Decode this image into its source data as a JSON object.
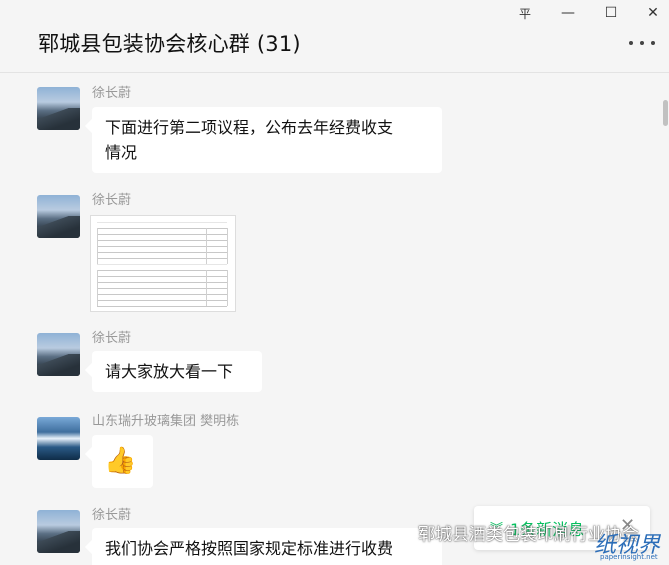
{
  "window": {
    "title": "郓城县包装协会核心群 (31)",
    "controls": {
      "pin": "平",
      "minimize": "—",
      "maximize": "☐",
      "close": "✕"
    },
    "more_icon": "more-icon"
  },
  "messages": [
    {
      "sender": "徐长蔚",
      "type": "text",
      "text_lines": [
        "下面进行第二项议程，公布去年经费收支",
        "情况"
      ]
    },
    {
      "sender": "徐长蔚",
      "type": "image",
      "icon": "document-image"
    },
    {
      "sender": "徐长蔚",
      "type": "text",
      "text_lines": [
        "请大家放大看一下"
      ]
    },
    {
      "sender": "山东瑞升玻璃集团 樊明栋",
      "type": "emoji",
      "emoji": "👍"
    },
    {
      "sender": "徐长蔚",
      "type": "text",
      "text_lines": [
        "我们协会严格按照国家规定标准进行收费"
      ]
    }
  ],
  "new_message_banner": {
    "label": "1条新消息",
    "chevron": "︾",
    "close": "✕"
  },
  "watermark": {
    "text": "郓城县酒类包装印刷行业协会",
    "logo": "纸视界",
    "sub": "paperinsight.net"
  }
}
